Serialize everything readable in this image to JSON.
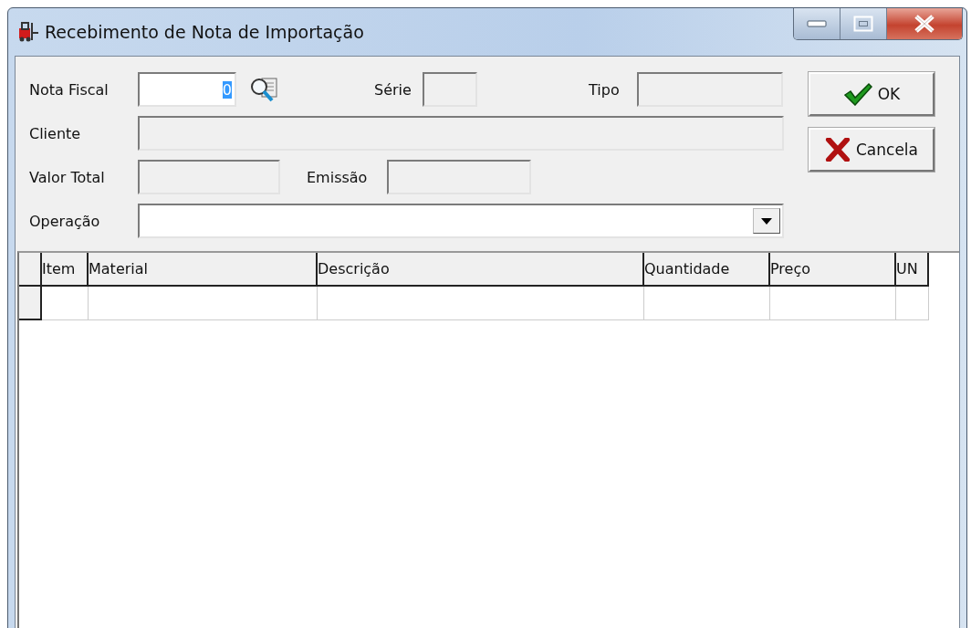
{
  "window": {
    "title": "Recebimento de Nota de Importação"
  },
  "form": {
    "nota_fiscal": {
      "label": "Nota Fiscal",
      "value": "0",
      "value_selected": true,
      "disabled": false
    },
    "serie": {
      "label": "Série",
      "disabled": true
    },
    "tipo": {
      "label": "Tipo",
      "disabled": true
    },
    "cliente": {
      "label": "Cliente",
      "disabled": true
    },
    "valor_total": {
      "label": "Valor Total",
      "disabled": true
    },
    "emissao": {
      "label": "Emissão",
      "disabled": true
    },
    "operacao": {
      "label": "Operação",
      "disabled": false
    }
  },
  "buttons": [
    {
      "label": "OK",
      "kind": "ok"
    },
    {
      "label": "Cancela",
      "kind": "cancel"
    }
  ],
  "table": {
    "columns": [
      "Item",
      "Material",
      "Descrição",
      "Quantidade",
      "Preço",
      "UN"
    ]
  }
}
